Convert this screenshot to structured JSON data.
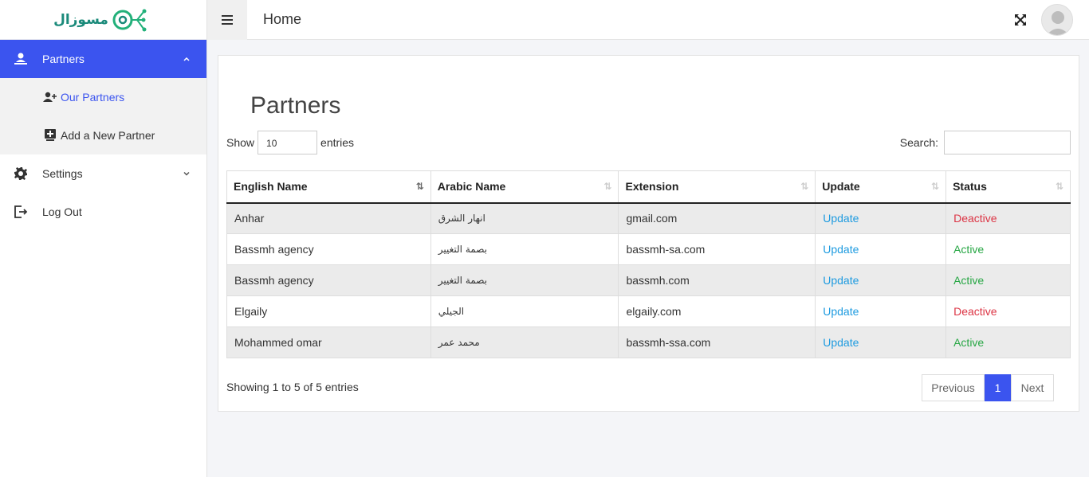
{
  "brand": {
    "logo_text": "مسوزال"
  },
  "header": {
    "title": "Home"
  },
  "sidebar": {
    "items": [
      {
        "label": "Partners"
      },
      {
        "label": "Settings"
      },
      {
        "label": "Log Out"
      }
    ],
    "sub_items": [
      {
        "label": "Our Partners"
      },
      {
        "label": "Add a New Partner"
      }
    ]
  },
  "main": {
    "title": "Partners",
    "show_label": "Show",
    "entries_value": "10",
    "entries_label": "entries",
    "search_label": "Search:",
    "columns": [
      "English Name",
      "Arabic Name",
      "Extension",
      "Update",
      "Status"
    ],
    "rows": [
      {
        "english": "Anhar",
        "arabic": "انهار الشرق",
        "extension": "gmail.com",
        "update": "Update",
        "status": "Deactive"
      },
      {
        "english": "Bassmh agency",
        "arabic": "بصمة التغيير",
        "extension": "bassmh-sa.com",
        "update": "Update",
        "status": "Active"
      },
      {
        "english": "Bassmh agency",
        "arabic": "بصمة التغيير",
        "extension": "bassmh.com",
        "update": "Update",
        "status": "Active"
      },
      {
        "english": "Elgaily",
        "arabic": "الجيلي",
        "extension": "elgaily.com",
        "update": "Update",
        "status": "Deactive"
      },
      {
        "english": "Mohammed omar",
        "arabic": "محمد عمر",
        "extension": "bassmh-ssa.com",
        "update": "Update",
        "status": "Active"
      }
    ],
    "info": "Showing 1 to 5 of 5 entries",
    "pagination": {
      "previous": "Previous",
      "current": "1",
      "next": "Next"
    }
  },
  "colors": {
    "accent": "#3b54ef",
    "link": "#1e9be0",
    "active": "#28a745",
    "deactive": "#dc3545"
  }
}
